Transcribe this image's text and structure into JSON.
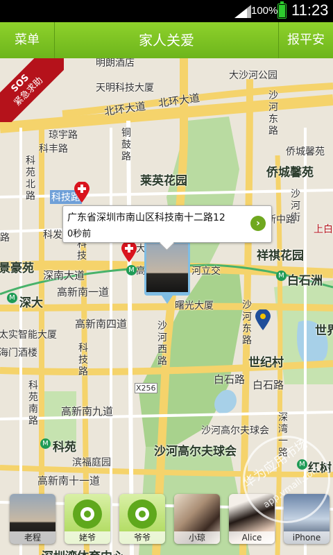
{
  "status_bar": {
    "battery": "100%",
    "time": "11:23"
  },
  "title_bar": {
    "menu": "菜单",
    "title": "家人关爱",
    "report_safe": "报平安"
  },
  "sos": {
    "line1": "SOS",
    "line2": "紧急求助"
  },
  "bubble": {
    "address": "广东省深圳市南山区科技南十二路12",
    "time": "0秒前"
  },
  "map_labels": {
    "minglang": "明朗酒店",
    "tianming": "天明科技大厦",
    "dashahe_park": "大沙河公园",
    "beihuan1": "北环大道",
    "beihuan2": "北环大道",
    "qiongyu": "琼宇路",
    "kefeng": "科丰路",
    "tonggu": "铜鼓路",
    "laiying": "莱英花园",
    "qiaocheng_yuan": "侨城馨苑",
    "qiaocheng": "侨城馨苑",
    "shahedong": "沙河东路",
    "keyuanbei": "科苑北路",
    "kejilu": "科技路",
    "shahe_jie": "沙河街",
    "keji_short": "科技",
    "kefa": "科发",
    "xinzhong": "新中路",
    "shangbai": "上白",
    "xiangqi": "祥祺花园",
    "jinghao": "景豪苑",
    "shennan": "深南大道",
    "shennan_bridge": "河立交",
    "baishizhou": "白石洲",
    "shenda": "深大",
    "gaoxinnan1": "高新南一道",
    "shuguang": "曙光大厦",
    "gaoxinnan4": "高新南四道",
    "taishi": "太实智能大厦",
    "haimen": "海门酒楼",
    "keyuan_road": "科苑南路",
    "shahexi": "沙河西路",
    "world": "世界",
    "shiji": "世纪村",
    "baishilu1": "白石路",
    "baishilu2": "白石路",
    "x256": "X256",
    "gaoxinnan9": "高新南九道",
    "golf_club": "沙河高尔夫球会",
    "golf_big": "沙河高尔夫球会",
    "shenwan": "深湾一路",
    "keyuan": "科苑",
    "binhai": "滨福庭园",
    "gaoxinnan11": "高新南十一道",
    "hongshulin": "红树",
    "sports": "深圳湾体育中心",
    "keji_sign": "科技",
    "da": "大",
    "gao": "高",
    "lu": "路"
  },
  "contacts": [
    {
      "name": "老程",
      "type": "photo-sunset"
    },
    {
      "name": "姥爷",
      "type": "bird-icon"
    },
    {
      "name": "爷爷",
      "type": "bird-icon"
    },
    {
      "name": "小琼",
      "type": "photo-girls"
    },
    {
      "name": "Alice",
      "type": "photo-girl"
    },
    {
      "name": "iPhone",
      "type": "photo-device"
    }
  ],
  "watermark": {
    "line1": "华为应用市场",
    "line2": "app.vmall.com"
  },
  "colors": {
    "title_green": "#7cc222",
    "sos_red": "#b5121b",
    "road_yellow": "#f5d36b",
    "park_green": "#b9dba1",
    "water_blue": "#a7d0e8"
  }
}
